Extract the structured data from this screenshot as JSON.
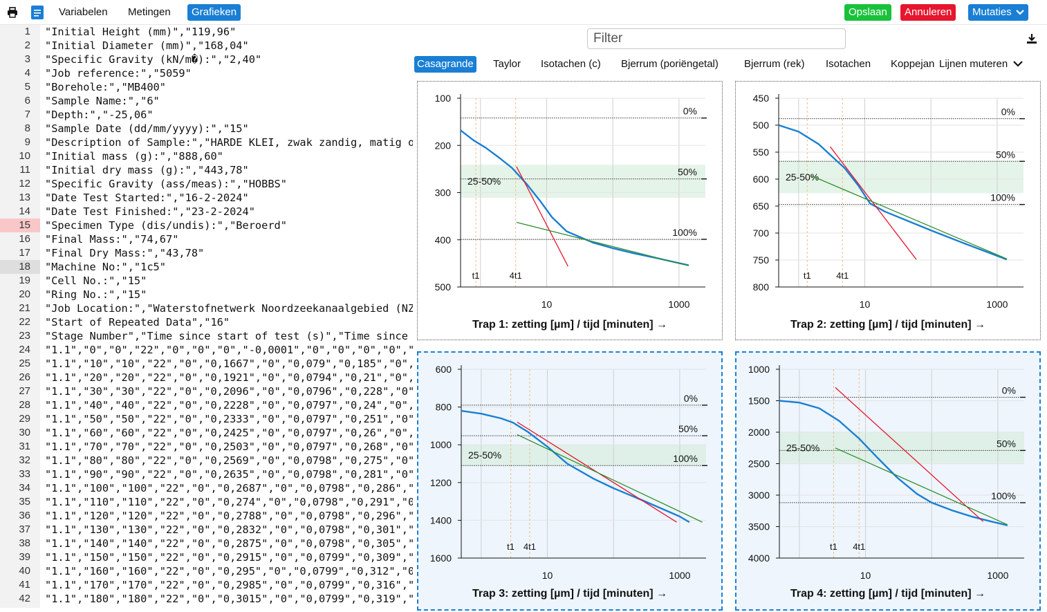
{
  "toolbar": {
    "print_icon": "printer-icon",
    "doc_icon": "document-icon",
    "menu": [
      "Variabelen",
      "Metingen",
      "Grafieken"
    ],
    "active_menu": "Grafieken",
    "save_label": "Opslaan",
    "cancel_label": "Annuleren",
    "mutations_label": "Mutaties",
    "colors": {
      "save": "#19c23a",
      "cancel": "#e6162e",
      "primary": "#1a7fd4"
    }
  },
  "editor": {
    "error_line": 15,
    "current_line": 18,
    "lines": [
      "\"Initial Height (mm)\",\"119,96\"",
      "\"Initial Diameter (mm)\",\"168,04\"",
      "\"Specific Gravity (kN/m�):\",\"2,40\"",
      "\"Job reference:\",\"5059\"",
      "\"Borehole:\",\"MB400\"",
      "\"Sample Name:\",\"6\"",
      "\"Depth:\",\"-25,06\"",
      "\"Sample Date (dd/mm/yyyy):\",\"15\"",
      "\"Description of Sample:\",\"HARDE KLEI, zwak zandig, matig or",
      "\"Initial mass (g):\",\"888,60\"",
      "\"Initial dry mass (g):\",\"443,78\"",
      "\"Specific Gravity (ass/meas):\",\"HOBBS\"",
      "\"Date Test Started:\",\"16-2-2024\"",
      "\"Date Test Finished:\",\"23-2-2024\"",
      "\"Specimen Type (dis/undis):\",\"Beroerd\"",
      "\"Final Mass:\",\"74,67\"",
      "\"Final Dry Mass:\",\"43,78\"",
      "\"Machine No:\",\"1c5\"",
      "\"Cell No.:\",\"15\"",
      "\"Ring No.:\",\"15\"",
      "\"Job Location:\",\"Waterstofnetwerk Noordzeekanaalgebied (NZK",
      "\"Start of Repeated Data\",\"16\"",
      "\"Stage Number\",\"Time since start of test (s)\",\"Time since s",
      "\"1.1\",\"0\",\"0\",\"22\",\"0\",\"0\",\"0\",\"-0,0001\",\"0\",\"0\",\"0\",\"0\",\"",
      "\"1.1\",\"10\",\"10\",\"22\",\"0\",\"0,1667\",\"0\",\"0,079\",\"0,185\",\"0\",\"",
      "\"1.1\",\"20\",\"20\",\"22\",\"0\",\"0,1921\",\"0\",\"0,0794\",\"0,21\",\"0\",\"",
      "\"1.1\",\"30\",\"30\",\"22\",\"0\",\"0,2096\",\"0\",\"0,0796\",\"0,228\",\"0\",",
      "\"1.1\",\"40\",\"40\",\"22\",\"0\",\"0,2228\",\"0\",\"0,0797\",\"0,24\",\"0\",\"",
      "\"1.1\",\"50\",\"50\",\"22\",\"0\",\"0,2333\",\"0\",\"0,0797\",\"0,251\",\"0\",",
      "\"1.1\",\"60\",\"60\",\"22\",\"0\",\"0,2425\",\"0\",\"0,0797\",\"0,26\",\"0\",\"",
      "\"1.1\",\"70\",\"70\",\"22\",\"0\",\"0,2503\",\"0\",\"0,0797\",\"0,268\",\"0\",",
      "\"1.1\",\"80\",\"80\",\"22\",\"0\",\"0,2569\",\"0\",\"0,0798\",\"0,275\",\"0\",",
      "\"1.1\",\"90\",\"90\",\"22\",\"0\",\"0,2635\",\"0\",\"0,0798\",\"0,281\",\"0\",",
      "\"1.1\",\"100\",\"100\",\"22\",\"0\",\"0,2687\",\"0\",\"0,0798\",\"0,286\",\"0",
      "\"1.1\",\"110\",\"110\",\"22\",\"0\",\"0,274\",\"0\",\"0,0798\",\"0,291\",\"0\"",
      "\"1.1\",\"120\",\"120\",\"22\",\"0\",\"0,2788\",\"0\",\"0,0798\",\"0,296\",\"0",
      "\"1.1\",\"130\",\"130\",\"22\",\"0\",\"0,2832\",\"0\",\"0,0798\",\"0,301\",\"0",
      "\"1.1\",\"140\",\"140\",\"22\",\"0\",\"0,2875\",\"0\",\"0,0798\",\"0,305\",\"0",
      "\"1.1\",\"150\",\"150\",\"22\",\"0\",\"0,2915\",\"0\",\"0,0799\",\"0,309\",\"0",
      "\"1.1\",\"160\",\"160\",\"22\",\"0\",\"0,295\",\"0\",\"0,0799\",\"0,312\",\"0\"",
      "\"1.1\",\"170\",\"170\",\"22\",\"0\",\"0,2985\",\"0\",\"0,0799\",\"0,316\",\"0",
      "\"1.1\",\"180\",\"180\",\"22\",\"0\",\"0,3015\",\"0\",\"0,0799\",\"0,319\",\"0"
    ]
  },
  "panel": {
    "filter_placeholder": "Filter",
    "download_icon": "download-icon",
    "tabs": [
      "Casagrande",
      "Taylor",
      "Isotachen (c)",
      "Bjerrum (poriëngetal)",
      "Bjerrum (rek)",
      "Isotachen",
      "Koppejan"
    ],
    "active_tab": "Casagrande",
    "mutate_lines_label": "Lijnen muteren"
  },
  "chart_data": [
    {
      "type": "line",
      "title": "Trap 1: zetting [µm] / tijd [minuten] →",
      "xscale": "log",
      "xlim": [
        0.5,
        2500
      ],
      "xticks": [
        "10",
        "1000"
      ],
      "ylim": [
        100,
        500
      ],
      "yticks": [
        "100",
        "200",
        "300",
        "400",
        "500"
      ],
      "markers": [
        {
          "label": "t1",
          "x": 0.85
        },
        {
          "label": "4t1",
          "x": 3.4
        }
      ],
      "levels": [
        {
          "label": "0%",
          "y": 142
        },
        {
          "label": "50%",
          "y": 271
        },
        {
          "label": "100%",
          "y": 399
        }
      ],
      "band": {
        "label": "25-50%",
        "y": [
          241,
          311
        ]
      },
      "grid": true,
      "series": [
        {
          "color": "#1a7fd4",
          "x": [
            0.5,
            0.8,
            1.2,
            2,
            3,
            5,
            8,
            12,
            20,
            50,
            100,
            200,
            500,
            1400
          ],
          "y": [
            168,
            190,
            205,
            228,
            248,
            282,
            318,
            352,
            382,
            406,
            418,
            428,
            440,
            454
          ]
        },
        {
          "color": "#e6162e",
          "x": [
            3.5,
            21
          ],
          "y": [
            245,
            456
          ]
        },
        {
          "color": "#2f8f2f",
          "x": [
            3.5,
            1400
          ],
          "y": [
            363,
            455
          ]
        }
      ]
    },
    {
      "type": "line",
      "title": "Trap 2: zetting [µm] / tijd [minuten] →",
      "xscale": "log",
      "xlim": [
        0.5,
        2500
      ],
      "xticks": [
        "10",
        "1000"
      ],
      "ylim": [
        450,
        800
      ],
      "yticks": [
        "450",
        "500",
        "550",
        "600",
        "650",
        "700",
        "750",
        "800"
      ],
      "markers": [
        {
          "label": "t1",
          "x": 1.35
        },
        {
          "label": "4t1",
          "x": 4.6
        }
      ],
      "levels": [
        {
          "label": "0%",
          "y": 488
        },
        {
          "label": "50%",
          "y": 567
        },
        {
          "label": "100%",
          "y": 647
        }
      ],
      "band": {
        "label": "25-50%",
        "y": [
          566,
          626
        ]
      },
      "grid": true,
      "series": [
        {
          "color": "#1a7fd4",
          "x": [
            0.5,
            1,
            2,
            3,
            5,
            8,
            12,
            20,
            50,
            100,
            300,
            1400
          ],
          "y": [
            500,
            512,
            535,
            555,
            580,
            612,
            645,
            660,
            680,
            695,
            718,
            749
          ]
        },
        {
          "color": "#e6162e",
          "x": [
            3,
            60
          ],
          "y": [
            540,
            749
          ]
        },
        {
          "color": "#2f8f2f",
          "x": [
            1.5,
            1400
          ],
          "y": [
            593,
            748
          ]
        }
      ]
    },
    {
      "type": "line",
      "title": "Trap 3: zetting [µm] / tijd [minuten] →",
      "xscale": "log",
      "xlim": [
        0.5,
        2500
      ],
      "xticks": [
        "10",
        "1000"
      ],
      "ylim": [
        600,
        1600
      ],
      "yticks": [
        "600",
        "800",
        "1000",
        "1200",
        "1400",
        "1600"
      ],
      "markers": [
        {
          "label": "t1",
          "x": 2.8
        },
        {
          "label": "4t1",
          "x": 5.4
        }
      ],
      "levels": [
        {
          "label": "0%",
          "y": 790
        },
        {
          "label": "50%",
          "y": 952
        },
        {
          "label": "100%",
          "y": 1110
        }
      ],
      "band": {
        "label": "25-50%",
        "y": [
          1000,
          1110
        ]
      },
      "grid": true,
      "series": [
        {
          "color": "#1a7fd4",
          "x": [
            0.5,
            1,
            2,
            3,
            5,
            10,
            20,
            50,
            100,
            300,
            1000,
            1400
          ],
          "y": [
            820,
            835,
            860,
            882,
            930,
            1010,
            1100,
            1180,
            1230,
            1300,
            1380,
            1410
          ]
        },
        {
          "color": "#e6162e",
          "x": [
            3.5,
            900
          ],
          "y": [
            880,
            1410
          ]
        },
        {
          "color": "#2f8f2f",
          "x": [
            3.5,
            2200
          ],
          "y": [
            946,
            1410
          ]
        }
      ]
    },
    {
      "type": "line",
      "title": "Trap 4: zetting [µm] / tijd [minuten] →",
      "xscale": "log",
      "xlim": [
        0.5,
        2500
      ],
      "xticks": [
        "10",
        "1000"
      ],
      "ylim": [
        1000,
        4000
      ],
      "yticks": [
        "1000",
        "1500",
        "2000",
        "2500",
        "3000",
        "3500",
        "4000"
      ],
      "markers": [
        {
          "label": "t1",
          "x": 3.3
        },
        {
          "label": "4t1",
          "x": 8
        }
      ],
      "levels": [
        {
          "label": "0%",
          "y": 1445
        },
        {
          "label": "50%",
          "y": 2290
        },
        {
          "label": "100%",
          "y": 3120
        }
      ],
      "band": {
        "label": "25-50%",
        "y": [
          2000,
          2490
        ]
      },
      "grid": true,
      "series": [
        {
          "color": "#1a7fd4",
          "x": [
            0.5,
            1,
            2,
            4,
            8,
            15,
            30,
            60,
            100,
            200,
            400,
            800,
            1400
          ],
          "y": [
            1500,
            1530,
            1620,
            1820,
            2100,
            2400,
            2720,
            2980,
            3120,
            3240,
            3340,
            3420,
            3480
          ]
        },
        {
          "color": "#e6162e",
          "x": [
            3.5,
            600
          ],
          "y": [
            1290,
            3420
          ]
        },
        {
          "color": "#2f8f2f",
          "x": [
            3.5,
            1400
          ],
          "y": [
            2250,
            3470
          ]
        }
      ]
    }
  ]
}
